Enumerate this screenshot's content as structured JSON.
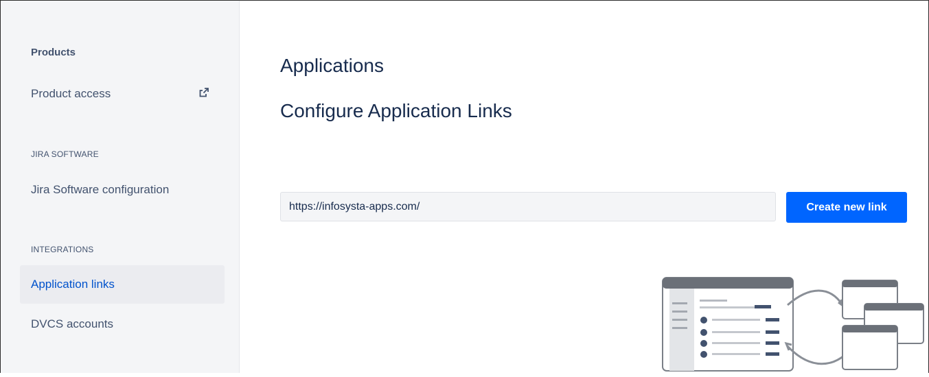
{
  "sidebar": {
    "products_heading": "Products",
    "product_access": "Product access",
    "jira_software_section": "JIRA SOFTWARE",
    "jira_software_configuration": "Jira Software configuration",
    "integrations_section": "INTEGRATIONS",
    "application_links": "Application links",
    "dvcs_accounts": "DVCS accounts",
    "active_item": "Application links"
  },
  "main": {
    "title": "Applications",
    "subtitle": "Configure Application Links",
    "url_input": {
      "value": "https://infosysta-apps.com/",
      "placeholder": ""
    },
    "create_button": "Create new link"
  },
  "colors": {
    "primary_button": "#0065ff",
    "active_link": "#0052cc",
    "sidebar_bg": "#f4f5f7",
    "heading_text": "#172b4d"
  },
  "icons": [
    "external-link-icon",
    "application-links-illustration"
  ]
}
